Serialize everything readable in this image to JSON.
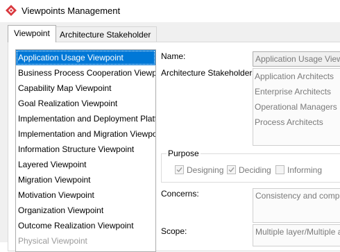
{
  "window": {
    "title": "Viewpoints Management",
    "icon": "diamond-logo-icon"
  },
  "tabs": [
    {
      "label": "Viewpoint",
      "active": true
    },
    {
      "label": "Architecture Stakeholder",
      "active": false
    }
  ],
  "viewpoints": {
    "selected": "Application Usage Viewpoint",
    "items": [
      "Application Usage Viewpoint",
      "Business Process Cooperation Viewpoint",
      "Capability Map Viewpoint",
      "Goal Realization Viewpoint",
      "Implementation and Deployment Platf…",
      "Implementation and Migration Viewpoint",
      "Information Structure Viewpoint",
      "Layered Viewpoint",
      "Migration Viewpoint",
      "Motivation Viewpoint",
      "Organization Viewpoint",
      "Outcome Realization Viewpoint",
      "Physical Viewpoint"
    ]
  },
  "form": {
    "name_label": "Name:",
    "name_value": "Application Usage Viewpo",
    "stakeholders_label": "Architecture Stakeholders:",
    "stakeholders": [
      "Application Architects",
      "Enterprise Architects",
      "Operational Managers",
      "Process Architects"
    ],
    "purpose_label": "Purpose",
    "purpose_options": [
      {
        "label": "Designing",
        "checked": true
      },
      {
        "label": "Deciding",
        "checked": true
      },
      {
        "label": "Informing",
        "checked": false
      }
    ],
    "concerns_label": "Concerns:",
    "concerns_value": "Consistency and complet",
    "scope_label": "Scope:",
    "scope_value": "Multiple layer/Multiple as"
  },
  "colors": {
    "selection": "#0078d7",
    "logo": "#d9383e"
  }
}
